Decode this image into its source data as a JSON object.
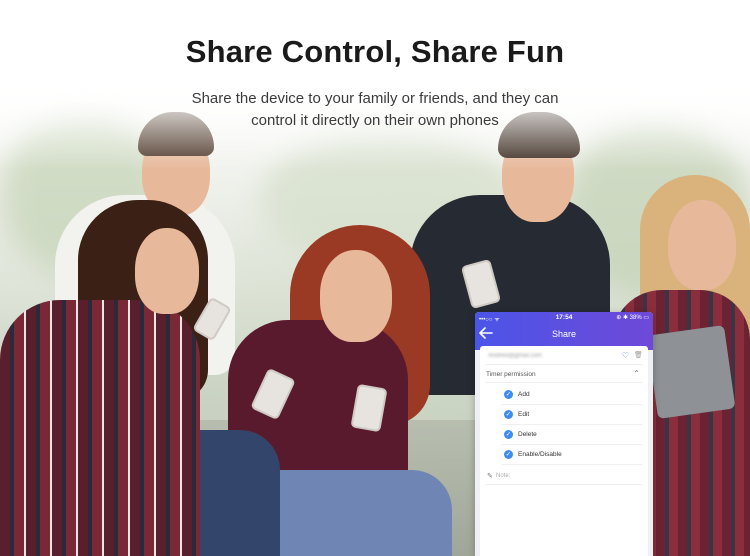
{
  "header": {
    "title": "Share Control, Share Fun",
    "subtitle_line1": "Share the device to your family or friends, and they can",
    "subtitle_line2": "control it directly on their own phones"
  },
  "phone": {
    "status": {
      "signal": "•••○○ ᯤ",
      "time": "17:54",
      "battery": "⊕ ✱ 38% ▭"
    },
    "nav": {
      "back_icon": "back-arrow-icon",
      "title": "Share"
    },
    "email": "Andrew@gmail.com",
    "permission": {
      "label": "Timer permission",
      "expanded": true,
      "options": [
        {
          "label": "Add",
          "checked": true
        },
        {
          "label": "Edit",
          "checked": true
        },
        {
          "label": "Delete",
          "checked": true
        },
        {
          "label": "Enable/Disable",
          "checked": true
        }
      ]
    },
    "note_label": "Note:",
    "accent": "#4a63e8",
    "header_gradient": [
      "#4b55e8",
      "#6e49d8"
    ]
  }
}
